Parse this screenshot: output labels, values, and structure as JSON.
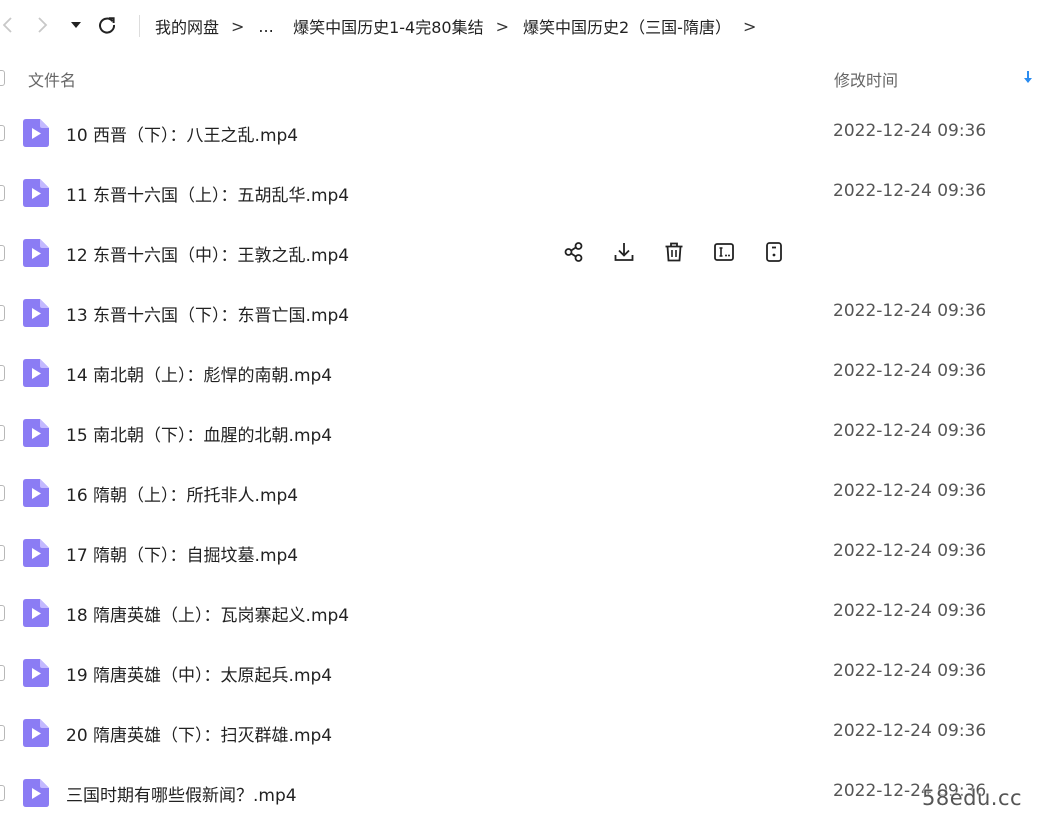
{
  "breadcrumb": {
    "items": [
      "我的网盘",
      "...",
      "爆笑中国历史1-4完80集结",
      "爆笑中国历史2（三国-隋唐）"
    ],
    "separator": ">"
  },
  "header": {
    "name_label": "文件名",
    "time_label": "修改时间",
    "sort_direction": "descending"
  },
  "colors": {
    "accent": "#2b8cf0",
    "file_icon": "#8b7cf4",
    "text": "#222222",
    "muted": "#666666"
  },
  "files": [
    {
      "name": "10 西晋（下）：八王之乱.mp4",
      "time": "2022-12-24 09:36"
    },
    {
      "name": "11 东晋十六国（上）：五胡乱华.mp4",
      "time": "2022-12-24 09:36"
    },
    {
      "name": "12 东晋十六国（中）：王敦之乱.mp4",
      "time": "",
      "hovered": true,
      "actions": [
        "share-icon",
        "download-icon",
        "delete-icon",
        "rename-icon",
        "more-icon"
      ]
    },
    {
      "name": "13 东晋十六国（下）：东晋亡国.mp4",
      "time": "2022-12-24 09:36"
    },
    {
      "name": "14 南北朝（上）：彪悍的南朝.mp4",
      "time": "2022-12-24 09:36"
    },
    {
      "name": "15 南北朝（下）：血腥的北朝.mp4",
      "time": "2022-12-24 09:36"
    },
    {
      "name": "16 隋朝（上）：所托非人.mp4",
      "time": "2022-12-24 09:36"
    },
    {
      "name": "17 隋朝（下）：自掘坟墓.mp4",
      "time": "2022-12-24 09:36"
    },
    {
      "name": "18 隋唐英雄（上）：瓦岗寨起义.mp4",
      "time": "2022-12-24 09:36"
    },
    {
      "name": "19 隋唐英雄（中）：太原起兵.mp4",
      "time": "2022-12-24 09:36"
    },
    {
      "name": "20 隋唐英雄（下）：扫灭群雄.mp4",
      "time": "2022-12-24 09:36"
    },
    {
      "name": "三国时期有哪些假新闻？.mp4",
      "time": "2022-12-24 09:36"
    }
  ],
  "watermark": "58edu.cc"
}
